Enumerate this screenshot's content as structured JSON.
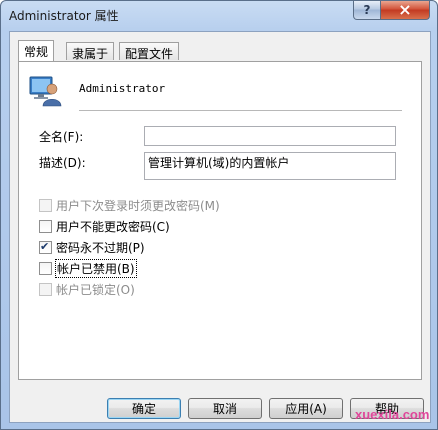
{
  "window": {
    "title": "Administrator 属性"
  },
  "titlebar": {
    "help_glyph": "?",
    "close_glyph": "×"
  },
  "tabs": [
    {
      "label": "常规",
      "active": true
    },
    {
      "label": "隶属于",
      "active": false
    },
    {
      "label": "配置文件",
      "active": false
    }
  ],
  "general": {
    "user_name": "Administrator",
    "full_name_label": "全名(F):",
    "full_name_value": "",
    "description_label": "描述(D):",
    "description_value": "管理计算机(域)的内置帐户",
    "checkboxes": [
      {
        "label": "用户下次登录时须更改密码(M)",
        "checked": false,
        "enabled": false
      },
      {
        "label": "用户不能更改密码(C)",
        "checked": false,
        "enabled": true
      },
      {
        "label": "密码永不过期(P)",
        "checked": true,
        "enabled": true
      },
      {
        "label": "帐户已禁用(B)",
        "checked": false,
        "enabled": true,
        "focused": true
      },
      {
        "label": "帐户已锁定(O)",
        "checked": false,
        "enabled": false
      }
    ]
  },
  "buttons": {
    "ok": "确定",
    "cancel": "取消",
    "apply": "应用(A)",
    "help": "帮助"
  },
  "watermark": "xuexila.com"
}
